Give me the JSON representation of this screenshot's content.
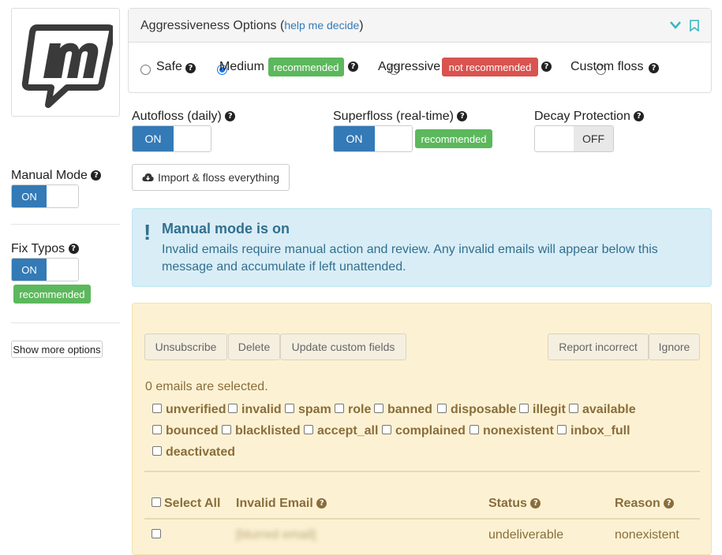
{
  "panel": {
    "title": "Aggressiveness Options",
    "help_link": "help me decide",
    "options": [
      {
        "label": "Safe",
        "checked": false
      },
      {
        "label": "Medium",
        "checked": true,
        "badge": "recommended"
      },
      {
        "label": "Aggressive",
        "checked": false,
        "badge": "not recommended"
      },
      {
        "label": "Custom floss",
        "checked": false
      }
    ]
  },
  "toggles": {
    "autofloss": {
      "label": "Autofloss (daily)",
      "state": "ON"
    },
    "superfloss": {
      "label": "Superfloss (real-time)",
      "state": "ON",
      "badge": "recommended"
    },
    "decay": {
      "label": "Decay Protection",
      "state": "OFF"
    },
    "manual_mode": {
      "label": "Manual Mode",
      "state": "ON"
    },
    "fix_typos": {
      "label": "Fix Typos",
      "state": "ON",
      "badge": "recommended"
    }
  },
  "buttons": {
    "import": "Import & floss everything",
    "show_more": "Show more options",
    "unsubscribe": "Unsubscribe",
    "delete": "Delete",
    "update_fields": "Update custom fields",
    "report_incorrect": "Report incorrect",
    "ignore": "Ignore"
  },
  "alert": {
    "title": "Manual mode is on",
    "message": "Invalid emails require manual action and review. Any invalid emails will appear below this message and accumulate if left unattended."
  },
  "selection": {
    "count_text": "0 emails are selected.",
    "filters": [
      "unverified",
      "invalid",
      "spam",
      "role",
      "banned",
      "disposable",
      "illegit",
      "available",
      "bounced",
      "blacklisted",
      "accept_all",
      "complained",
      "nonexistent",
      "inbox_full",
      "deactivated"
    ]
  },
  "table": {
    "select_all": "Select All",
    "headers": {
      "email": "Invalid Email",
      "status": "Status",
      "reason": "Reason"
    },
    "rows": [
      {
        "email": "[blurred email]",
        "status": "undeliverable",
        "reason": "nonexistent"
      }
    ]
  },
  "colors": {
    "primary": "#337ab7",
    "success": "#5cb85c",
    "danger": "#d9534f",
    "info_bg": "#d9edf7",
    "warning_bg": "#fcf2d3",
    "warning_text": "#8a6d3b"
  }
}
